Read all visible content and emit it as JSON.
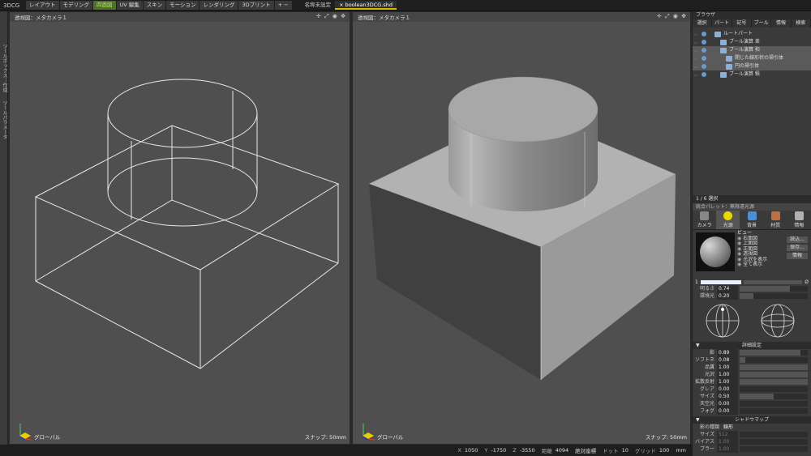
{
  "app": {
    "title": "3DCG"
  },
  "mode_tabs": [
    {
      "label": "レイアウト",
      "active": false
    },
    {
      "label": "モデリング",
      "active": false
    },
    {
      "label": "四面図",
      "active": true
    },
    {
      "label": "UV 編集",
      "active": false
    },
    {
      "label": "スキン",
      "active": false
    },
    {
      "label": "モーション",
      "active": false
    },
    {
      "label": "レンダリング",
      "active": false
    },
    {
      "label": "3Dプリント",
      "active": false
    },
    {
      "label": "+ −",
      "active": false
    }
  ],
  "doc_tabs": [
    {
      "label": "名称未設定",
      "active": false
    },
    {
      "label": "× boolean3DCG.shd",
      "active": true
    }
  ],
  "left_strip": {
    "label1": "ツールボックス：作成",
    "label2": "ツールパラメータ"
  },
  "viewports": {
    "left": {
      "title": "透視図：メタカメラ１",
      "snap": "スナップ: 50mm",
      "global": "グローバル",
      "tools": "✛ ⤢ ◉ ✥"
    },
    "right": {
      "title": "透視図：メタカメラ１",
      "snap": "スナップ: 50mm",
      "global": "グローバル",
      "tools": "✛ ⤢ ◉ ✥"
    }
  },
  "status": {
    "x_label": "X",
    "x": "1050",
    "y_label": "Y",
    "y": "-1750",
    "z_label": "Z",
    "z": "-3550",
    "dist_label": "距離",
    "dist": "4094",
    "abs_label": "絶対座標",
    "dot_label": "ドット",
    "dot": "10",
    "grid_label": "グリッド",
    "grid": "100",
    "unit": "mm"
  },
  "browser": {
    "header": "ブラウザ",
    "tabs": [
      "選択",
      "パート",
      "記号",
      "ブール",
      "情報",
      "検索"
    ],
    "tree": [
      {
        "label": "ルートパート",
        "indent": 1,
        "selected": false
      },
      {
        "label": "ブール演算 差",
        "indent": 2,
        "selected": false
      },
      {
        "label": "ブール演算 和",
        "indent": 2,
        "selected": true
      },
      {
        "label": "開じた線形状の掃引体",
        "indent": 3,
        "selected": true
      },
      {
        "label": "円の掃引体",
        "indent": 3,
        "selected": true
      },
      {
        "label": "ブール演算 積",
        "indent": 2,
        "selected": false
      }
    ],
    "selection_count": "1 / 6 選択"
  },
  "palette": {
    "header": "統合パレット：無限遠光源",
    "tabs": [
      {
        "label": "カメラ",
        "color": "#888888",
        "active": false
      },
      {
        "label": "光源",
        "color": "#e8d800",
        "active": true
      },
      {
        "label": "背景",
        "color": "#4a90d0",
        "active": false
      },
      {
        "label": "材質",
        "color": "#c07040",
        "active": false
      },
      {
        "label": "情報",
        "color": "#b0b0b0",
        "active": false
      }
    ],
    "view_label": "ビュー",
    "view_options": [
      "右面図",
      "上面図",
      "正面図",
      "透視図",
      "光沢を表示",
      "全て表示"
    ],
    "buttons": [
      "読込...",
      "保存...",
      "情報"
    ],
    "brightness_label": "明るさ",
    "brightness": "0.74",
    "ambient_label": "環境光",
    "ambient": "0.20",
    "detail_header": "詳細設定",
    "details": [
      {
        "label": "影",
        "value": "0.89",
        "level": 0.89
      },
      {
        "label": "ソフトネス",
        "value": "0.08",
        "level": 0.08
      },
      {
        "label": "品質",
        "value": "1.00",
        "level": 1.0
      },
      {
        "label": "光沢",
        "value": "1.00",
        "level": 1.0
      },
      {
        "label": "拡散反射",
        "value": "1.00",
        "level": 1.0
      },
      {
        "label": "グレア",
        "value": "0.00",
        "level": 0.0
      },
      {
        "label": "サイズ",
        "value": "0.50",
        "level": 0.5
      },
      {
        "label": "天空光",
        "value": "0.00",
        "level": 0.0
      },
      {
        "label": "フォグ",
        "value": "0.00",
        "level": 0.0
      }
    ],
    "shadow_header": "シャドウマップ",
    "shadow_type_label": "影の種類",
    "shadow_type": "線形",
    "shadow_rows": [
      {
        "label": "サイズ",
        "value": "512"
      },
      {
        "label": "バイアス",
        "value": "1.00"
      },
      {
        "label": "ブラー",
        "value": "1.00"
      }
    ]
  }
}
